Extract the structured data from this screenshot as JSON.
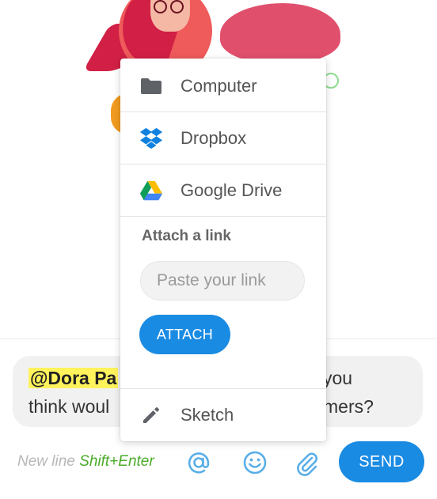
{
  "popup": {
    "menu_items": [
      {
        "label": "Computer",
        "icon": "folder-icon"
      },
      {
        "label": "Dropbox",
        "icon": "dropbox-icon"
      },
      {
        "label": "Google Drive",
        "icon": "google-drive-icon"
      }
    ],
    "link_section": {
      "title": "Attach a link",
      "placeholder": "Paste your link",
      "attach_label": "ATTACH"
    },
    "sketch": {
      "label": "Sketch",
      "icon": "pencil-icon"
    }
  },
  "composer": {
    "mention": "@Dora Pa",
    "line1_tail": "you",
    "line2_head": "think woul",
    "line2_tail": "mers?",
    "hint_prefix": "New line",
    "hint_key": "Shift+Enter",
    "send_label": "SEND"
  },
  "colors": {
    "accent": "#1a8be3",
    "mention_highlight": "#fff35c",
    "hint_key": "#4bab2a"
  }
}
